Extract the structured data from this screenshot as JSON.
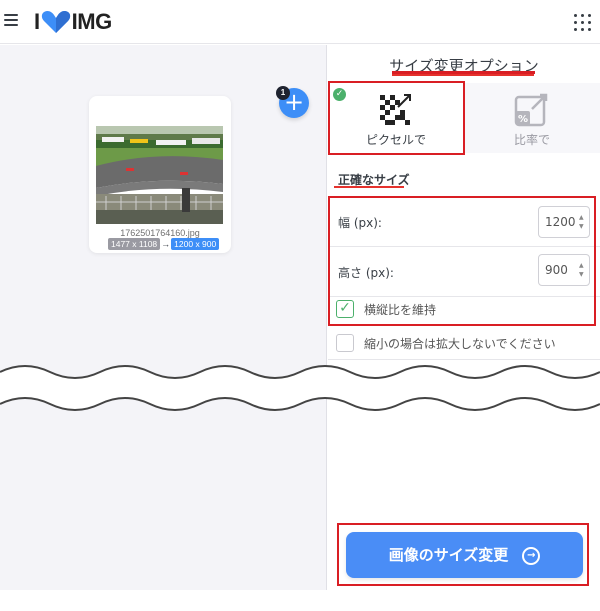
{
  "header": {
    "logo_i": "I",
    "logo_img": "IMG",
    "brand_color": "#e5322d"
  },
  "workspace": {
    "file": {
      "name": "1762501764160.jpg",
      "original_size": "1477 x 1108",
      "new_size": "1200 x 900"
    },
    "add_count": "1"
  },
  "panel": {
    "title": "サイズ変更オプション",
    "modes": [
      {
        "label": "ピクセルで",
        "selected": true,
        "icon": "pixel-resize-icon"
      },
      {
        "label": "比率で",
        "selected": false,
        "icon": "percent-resize-icon"
      }
    ],
    "section_label": "正確なサイズ",
    "width": {
      "label": "幅 (px):",
      "value": "1200"
    },
    "height": {
      "label": "高さ (px):",
      "value": "900"
    },
    "keep_ratio": {
      "label": "横縦比を維持",
      "checked": true
    },
    "no_enlarge": {
      "label": "縮小の場合は拡大しないでください",
      "checked": false
    },
    "submit_label": "画像のサイズ変更"
  },
  "colors": {
    "accent_blue": "#4a8df6",
    "success_green": "#4bb06b",
    "highlight_red": "#d91e24"
  }
}
